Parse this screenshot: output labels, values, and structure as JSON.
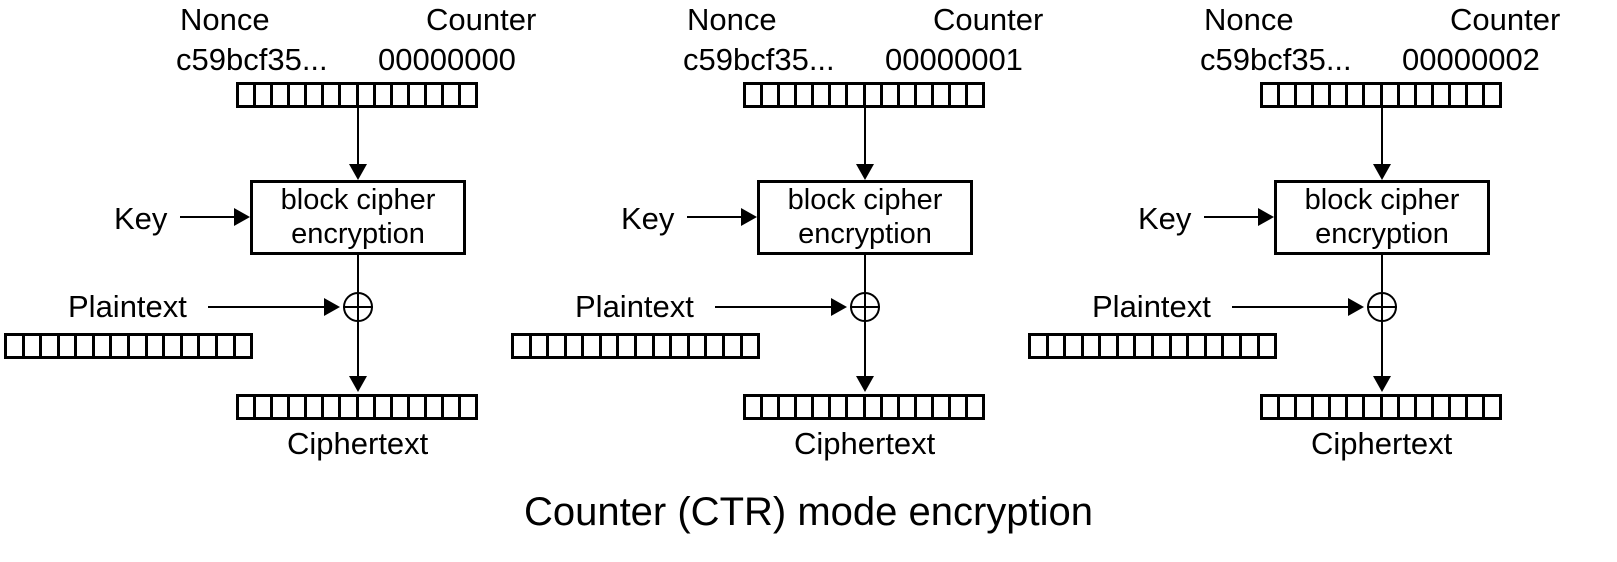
{
  "diagram": {
    "caption": "Counter (CTR) mode encryption",
    "background_color": "#ffffff",
    "stroke_color": "#000000",
    "bit_cell_count": 14,
    "labels": {
      "nonce": "Nonce",
      "counter": "Counter",
      "nonce_value": "c59bcf35...",
      "key": "Key",
      "plaintext": "Plaintext",
      "ciphertext": "Ciphertext",
      "cipher_line1": "block cipher",
      "cipher_line2": "encryption"
    },
    "blocks": [
      {
        "index": 1,
        "counter_value": "00000000"
      },
      {
        "index": 2,
        "counter_value": "00000001"
      },
      {
        "index": 3,
        "counter_value": "00000002"
      }
    ]
  }
}
